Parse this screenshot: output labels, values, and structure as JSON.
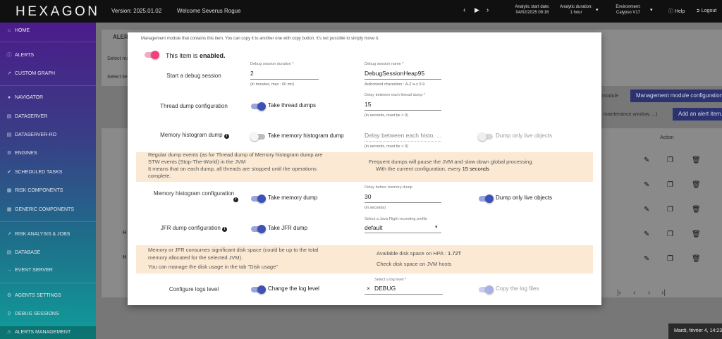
{
  "topbar": {
    "logo": "HEXAGON",
    "version": "Version: 2025.01.02",
    "welcome": "Welcome Severus Rogue",
    "analytic_start_label": "Analytic start date:",
    "analytic_start_value": "04/02/2025 09:16",
    "analytic_duration_label": "Analytic duration:",
    "analytic_duration_value": "1 hour",
    "environment_label": "Environment:",
    "environment_value": "Calypso V17",
    "help": "Help",
    "logout": "Logout"
  },
  "sidebar": {
    "items": [
      {
        "label": "HOME",
        "icon": "home-icon"
      },
      {
        "label": "ALERTS",
        "icon": "alert-circle-icon"
      },
      {
        "label": "CUSTOM GRAPH",
        "icon": "trending-icon"
      },
      {
        "label": "NAVIGATOR",
        "icon": "location-pin-icon"
      },
      {
        "label": "DATASERVER",
        "icon": "server-icon"
      },
      {
        "label": "DATASERVER-RO",
        "icon": "server-icon"
      },
      {
        "label": "ENGINES",
        "icon": "gear-icon"
      },
      {
        "label": "SCHEDULED TASKS",
        "icon": "check-circle-icon"
      },
      {
        "label": "RISK COMPONENTS",
        "icon": "components-icon"
      },
      {
        "label": "GENERIC COMPONENTS",
        "icon": "grid-icon"
      },
      {
        "label": "RISK ANALYSIS & JOBS",
        "icon": "chart-icon"
      },
      {
        "label": "DATABASE",
        "icon": "database-icon"
      },
      {
        "label": "EVENT SERVER",
        "icon": "event-icon"
      },
      {
        "label": "AGENTS SETTINGS",
        "icon": "gear-icon"
      },
      {
        "label": "DEBUG SESSIONS",
        "icon": "search-icon"
      },
      {
        "label": "ALERTS MANAGEMENT",
        "icon": "warning-icon"
      }
    ]
  },
  "background": {
    "title_partial": "ALER",
    "select_partial_1": "Select ma",
    "select_partial_2": "Select ite",
    "module_partial": "module",
    "mgmt_config_button": "Management module configuration.",
    "maintenance_partial": "s, maintenance window, ...)",
    "add_alert_button": "Add an alert item.",
    "col_partial": "s",
    "action_header": "Action",
    "row_partial_1": "H",
    "row_partial_2": "H",
    "toast": "Mardi, février  4, 14:23"
  },
  "modal": {
    "intro": "Management module that contains this item. You can copy it to another one with copy button. It's not possible to simply move it.",
    "enabled_prefix": "This item is ",
    "enabled_word": "enabled.",
    "debug": {
      "label": "Start a debug session",
      "duration_label": "Debug session duration *",
      "duration_value": "2",
      "duration_hint": "(in minutes, max : 60 mn)",
      "name_label": "Debug session name *",
      "name_value": "DebugSessionHeap95",
      "name_hint": "Authorized characters : A-Z a-z 0-9"
    },
    "thread": {
      "label": "Thread dump configuration",
      "switch_label": "Take thread dumps",
      "delay_label": "Delay between each thread dump *",
      "delay_value": "15",
      "delay_hint": "(in seconds, must be > 0)"
    },
    "histo": {
      "label": "Memory histogram dump",
      "switch_label": "Take memory histogram dump",
      "delay_placeholder": "Delay between each histo. ...",
      "delay_hint": "(in seconds, must be > 0)",
      "live_label": "Dump only live objects"
    },
    "warn1": {
      "left_l1": "Regular dump events (as for Thread dump of Memory histogram dump are",
      "left_l2": "STW events (Stop-The-World) in the JVM",
      "left_l3": "It means that on each dump, all threads are stopped until the operations",
      "left_l4": "complete.",
      "right_l1": "Frequent dumps will pause the JVM and slow down global processing.",
      "right_l2_prefix": "With the current configuration, every ",
      "right_l2_value": "15 seconds"
    },
    "memdump": {
      "label": "Memory histogram configuration",
      "switch_label": "Take memory dump",
      "delay_label": "Delay before memory dump",
      "delay_value": "30",
      "delay_hint": "(in seconds)",
      "live_label": "Dump only live objects"
    },
    "jfr": {
      "label": "JFR dump configuration",
      "switch_label": "Take JFR dump",
      "profile_label": "Select a Java Flight recording profile",
      "profile_value": "default"
    },
    "warn2": {
      "left_l1": "Memory or JFR consumes significant disk space (could be up to the total",
      "left_l2": "memory allocated for the selected JVM).",
      "left_l3": "You can manage the disk usage in the tab \"Disk usage\"",
      "right_l1_prefix": "Available disk space on HPA : ",
      "right_l1_value": "1.72T",
      "right_l2": "Check disk space on JVM hosts"
    },
    "logs": {
      "label": "Configure logs level",
      "switch_label": "Change the log level",
      "level_label": "Select a log level *",
      "level_value": "DEBUG",
      "copy_label": "Copy the log files"
    }
  }
}
